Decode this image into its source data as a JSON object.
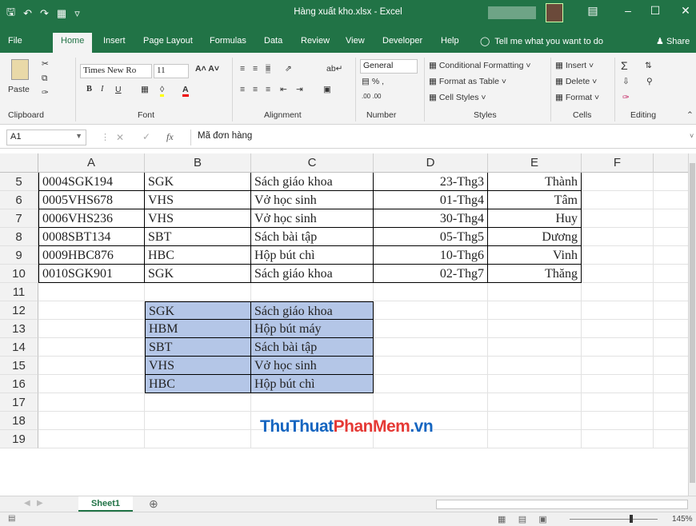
{
  "window": {
    "title": "Hàng xuất kho.xlsx - Excel"
  },
  "ribbon_tabs": [
    "File",
    "Home",
    "Insert",
    "Page Layout",
    "Formulas",
    "Data",
    "Review",
    "View",
    "Developer",
    "Help"
  ],
  "tell_me": "Tell me what you want to do",
  "share": "Share",
  "ribbon": {
    "clipboard": {
      "paste": "Paste",
      "label": "Clipboard"
    },
    "font": {
      "name": "Times New Ro",
      "size": "11",
      "label": "Font"
    },
    "alignment": {
      "label": "Alignment"
    },
    "number": {
      "format": "General",
      "label": "Number"
    },
    "styles": {
      "conditional": "Conditional Formatting",
      "format_table": "Format as Table",
      "cell_styles": "Cell Styles",
      "label": "Styles"
    },
    "cells": {
      "insert": "Insert",
      "delete": "Delete",
      "format": "Format",
      "label": "Cells"
    },
    "editing": {
      "label": "Editing"
    }
  },
  "formula_bar": {
    "name_box": "A1",
    "fx": "fx",
    "content": "Mã đơn hàng"
  },
  "columns": [
    "A",
    "B",
    "C",
    "D",
    "E",
    "F"
  ],
  "rows": [
    "5",
    "6",
    "7",
    "8",
    "9",
    "10",
    "11",
    "12",
    "13",
    "14",
    "15",
    "16",
    "17",
    "18",
    "19"
  ],
  "main_table": [
    [
      "0004SGK194",
      "SGK",
      "Sách giáo khoa",
      "23-Thg3",
      "Thành"
    ],
    [
      "0005VHS678",
      "VHS",
      "Vở học sinh",
      "01-Thg4",
      "Tâm"
    ],
    [
      "0006VHS236",
      "VHS",
      "Vở học sinh",
      "30-Thg4",
      "Huy"
    ],
    [
      "0008SBT134",
      "SBT",
      "Sách bài tập",
      "05-Thg5",
      "Dương"
    ],
    [
      "0009HBC876",
      "HBC",
      "Hộp bút chì",
      "10-Thg6",
      "Vinh"
    ],
    [
      "0010SGK901",
      "SGK",
      "Sách giáo khoa",
      "02-Thg7",
      "Thăng"
    ]
  ],
  "lookup_table": [
    [
      "SGK",
      "Sách giáo khoa"
    ],
    [
      "HBM",
      "Hộp bút máy"
    ],
    [
      "SBT",
      "Sách bài tập"
    ],
    [
      "VHS",
      "Vở học sinh"
    ],
    [
      "HBC",
      "Hộp bút chì"
    ]
  ],
  "watermark": {
    "part1": "ThuThuat",
    "part2": "PhanMem",
    "part3": ".vn"
  },
  "sheet_tab": "Sheet1",
  "zoom": "145%",
  "colors": {
    "excel_green": "#217346",
    "lookup_fill": "#b4c6e7"
  }
}
